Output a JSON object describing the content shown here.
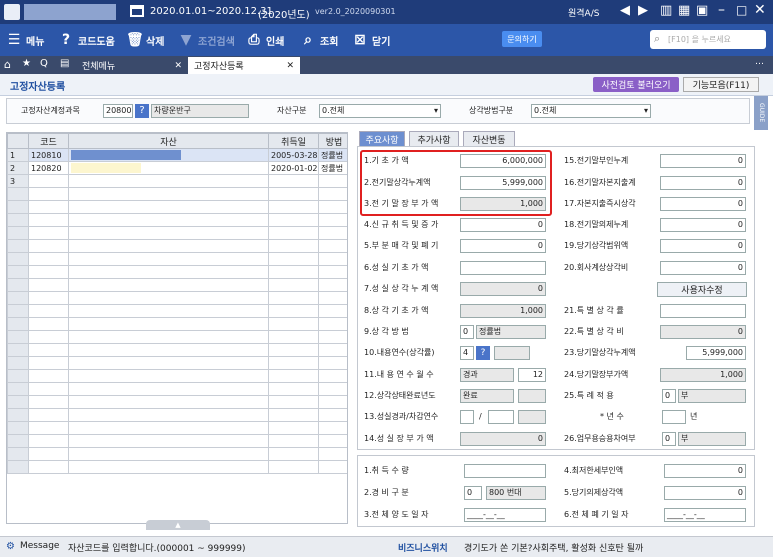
{
  "titlebar": {
    "date_range": "2020.01.01~2020.12.31",
    "year_label": "(2020년도)",
    "version": "ver2.0_2020090301",
    "remote": "원격A/S"
  },
  "toolbar": {
    "menu": "메뉴",
    "help": "코드도움",
    "delete": "삭제",
    "filter": "조건검색",
    "print": "인쇄",
    "inquiry": "조회",
    "close": "닫기",
    "inquire_btn": "문의하기",
    "search_placeholder": "[F10] 을 누르세요"
  },
  "tabs": {
    "all_menu": "전체메뉴",
    "current": "고정자산등록"
  },
  "page": {
    "title": "고정자산등록",
    "btn_precheck": "사전검토 불러오기",
    "btn_functions": "기능모음(F11)",
    "guide": "GUIDE"
  },
  "filter": {
    "account_label": "고정자산계정과목",
    "account_code": "20800",
    "account_name": "차량운반구",
    "asset_type_label": "자산구분",
    "asset_type_value": "0.전체",
    "method_label": "상각방법구분",
    "method_value": "0.전체"
  },
  "grid": {
    "headers": [
      "코드",
      "자산",
      "취득일",
      "방법"
    ],
    "rows": [
      {
        "no": "1",
        "code": "120810",
        "asset": "",
        "date": "2005-03-28",
        "method": "정률법"
      },
      {
        "no": "2",
        "code": "120820",
        "asset": "",
        "date": "2020-01-02",
        "method": "정률법"
      },
      {
        "no": "3",
        "code": "",
        "asset": "",
        "date": "",
        "method": ""
      }
    ]
  },
  "subtabs": [
    "주요사항",
    "추가사항",
    "자산변동"
  ],
  "fields_left": [
    {
      "label": "1.기 초 가 액",
      "value": "6,000,000"
    },
    {
      "label": "2.전기말상각누계액",
      "value": "5,999,000"
    },
    {
      "label": "3.전 기 말 장 부 가 액",
      "value": "1,000"
    },
    {
      "label": "4.신 규 취 득 및 증 가",
      "value": "0"
    },
    {
      "label": "5.부 분 매 각 및 폐 기",
      "value": "0"
    },
    {
      "label": "6.성 실 기 초 가 액",
      "value": ""
    },
    {
      "label": "7.성 실 상 각 누 계 액",
      "value": "0"
    },
    {
      "label": "8.상 각 기 초 가 액",
      "value": "1,000"
    },
    {
      "label": "9.상   각   방   법",
      "value": "0",
      "extra": "정률법"
    },
    {
      "label": "10.내용연수(상각률)",
      "value": "4"
    },
    {
      "label": "11.내 용 연 수 월 수",
      "value": "경과",
      "extra": "12"
    },
    {
      "label": "12.상각상태완료년도",
      "value": "완료"
    },
    {
      "label": "13.성실경과/차감연수",
      "value": "",
      "extra": "/"
    },
    {
      "label": "14.성 실 장 부 가 액",
      "value": "0"
    }
  ],
  "fields_right": [
    {
      "label": "15.전기말부인누계",
      "value": "0"
    },
    {
      "label": "16.전기말자본지출계",
      "value": "0"
    },
    {
      "label": "17.자본지출즉시상각",
      "value": "0"
    },
    {
      "label": "18.전기말의제누계",
      "value": "0"
    },
    {
      "label": "19.당기상각범위액",
      "value": "0"
    },
    {
      "label": "20.회사계상상각비",
      "value": "0"
    },
    {
      "label": "사용자수정",
      "value": ""
    },
    {
      "label": "21.특 별 상 각 률",
      "value": ""
    },
    {
      "label": "22.특 별 상 각 비",
      "value": "0"
    },
    {
      "label": "23.당기말상각누계액",
      "value": "5,999,000"
    },
    {
      "label": "24.당기말장부가액",
      "value": "1,000"
    },
    {
      "label": "25.특 례 적 용",
      "value": "0",
      "extra": "부"
    },
    {
      "label": "* 년 수",
      "value": "",
      "extra": "년"
    },
    {
      "label": "26.업무용승용차여부",
      "value": "0",
      "extra": "부"
    }
  ],
  "bottom_left": [
    {
      "label": "1.취 득 수 량",
      "value": ""
    },
    {
      "label": "2.경 비 구 분",
      "value": "0",
      "extra": "800 번대"
    },
    {
      "label": "3.전 체 양 도 일 자",
      "value": "____-__-__"
    }
  ],
  "bottom_right": [
    {
      "label": "4.최저한세부인액",
      "value": "0"
    },
    {
      "label": "5.당기의제상각액",
      "value": "0"
    },
    {
      "label": "6.전 체 폐 기 일 자",
      "value": "____-__-__"
    }
  ],
  "status": {
    "message_label": "Message",
    "message": "자산코드를 입력합니다.(000001 ~ 999999)",
    "switch_label": "비즈니스위치",
    "ticker": "경기도가 쏜 기본?사회주택, 활성화 신호탄 될까"
  }
}
